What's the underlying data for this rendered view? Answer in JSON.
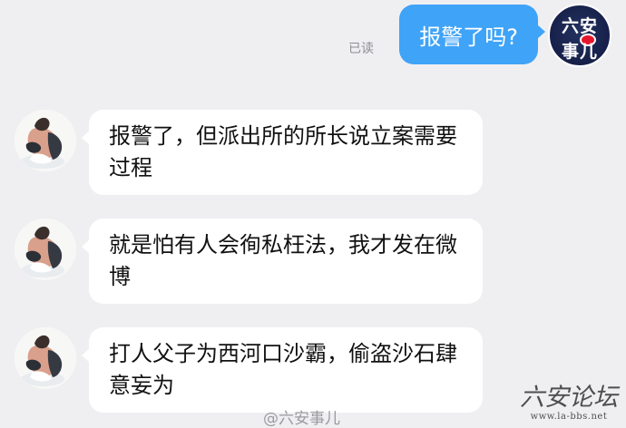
{
  "conversation": {
    "self_avatar": {
      "line1": "六安",
      "line2": "事儿"
    },
    "read_status": "已读",
    "messages": [
      {
        "sender": "self",
        "text": "报警了吗?"
      },
      {
        "sender": "peer",
        "text": "报警了，但派出所的所长说立案需要过程"
      },
      {
        "sender": "peer",
        "text": "就是怕有人会徇私枉法，我才发在微博"
      },
      {
        "sender": "peer",
        "text": "打人父子为西河口沙霸，偷盗沙石肆意妄为"
      }
    ]
  },
  "watermark": {
    "weibo_text": "@六安事儿",
    "site_logo_title": "六安论坛",
    "site_logo_url": "www.la-bbs.net"
  },
  "colors": {
    "background": "#efeff2",
    "outgoing_bubble": "#3fa3f8",
    "incoming_bubble": "#ffffff",
    "avatar_bg": "#16204a",
    "weibo_red": "#e6162d"
  }
}
